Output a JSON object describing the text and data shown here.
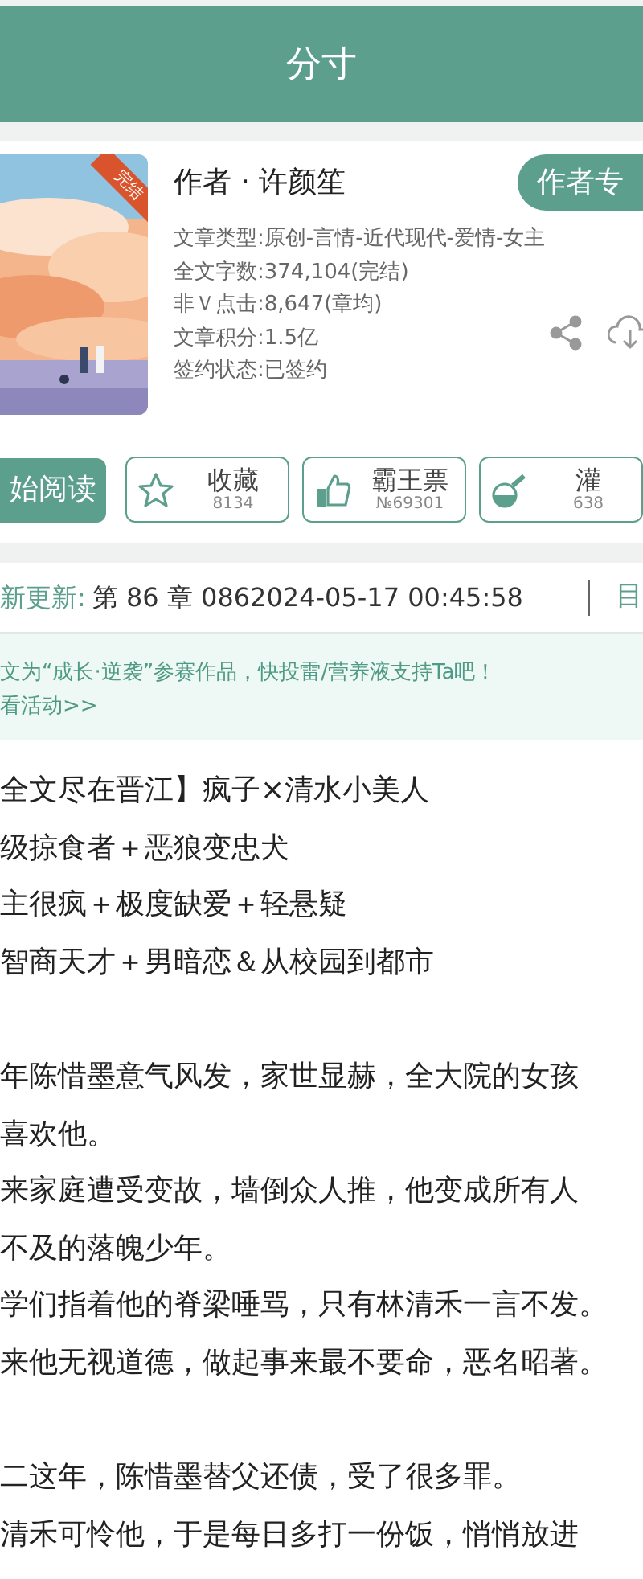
{
  "header": {
    "title": "分寸"
  },
  "book": {
    "cover_badge": "完结",
    "author": "作者 · 许颜笙",
    "author_button": "作者专",
    "details": [
      "文章类型:原创-言情-近代现代-爱情-女主",
      "全文字数:374,104(完结)",
      "非Ｖ点击:8,647(章均)",
      "文章积分:1.5亿",
      "签约状态:已签约"
    ]
  },
  "actions": {
    "read_button": "始阅读",
    "stats": [
      {
        "kind": "star",
        "label": "收藏",
        "count": "8134"
      },
      {
        "kind": "thumb",
        "label": "霸王票",
        "count": "№69301"
      },
      {
        "kind": "flask",
        "label": "灌",
        "count": "638"
      }
    ]
  },
  "update": {
    "label": "新更新:",
    "text": "第 86 章 0862024-05-17 00:45:58",
    "link": "目"
  },
  "notice": {
    "lines": [
      "文为“成长·逆袭”参赛作品，快投雷/营养液支持Ta吧！",
      "看活动>>"
    ]
  },
  "synopsis": [
    [
      "全文尽在晋江】疯子×清水小美人",
      "级掠食者＋恶狼变忠犬",
      "主很疯＋极度缺爱＋轻悬疑",
      "智商天才＋男暗恋＆从校园到都市"
    ],
    [
      "年陈惜墨意气风发，家世显赫，全大院的女孩",
      "喜欢他。",
      "来家庭遭受变故，墙倒众人推，他变成所有人",
      "不及的落魄少年。",
      "学们指着他的脊梁唾骂，只有林清禾一言不发。",
      "来他无视道德，做起事来最不要命，恶名昭著。"
    ],
    [
      "二这年，陈惜墨替父还债，受了很多罪。",
      "清禾可怜他，于是每日多打一份饭，悄悄放进"
    ]
  ]
}
